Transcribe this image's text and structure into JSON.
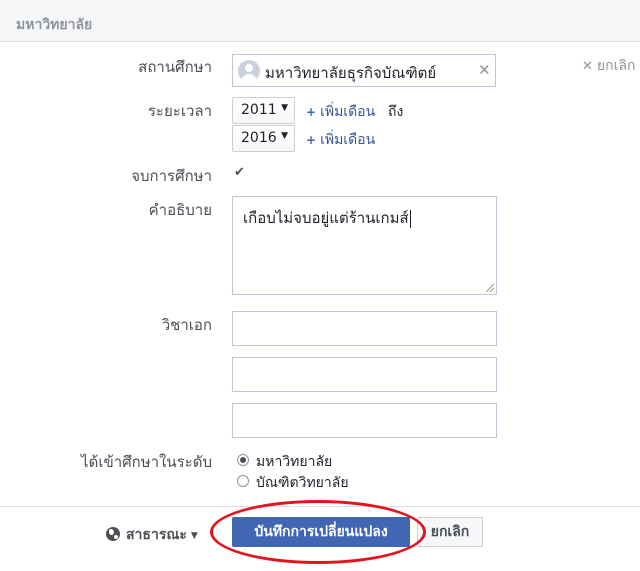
{
  "header": {
    "title": "มหาวิทยาลัย"
  },
  "form": {
    "school": {
      "label": "สถานศึกษา",
      "value": "มหาวิทยาลัยธุรกิจบัณฑิตย์",
      "clear_icon": "close-icon"
    },
    "cancel_top": "ยกเลิก",
    "period": {
      "label": "ระยะเวลา",
      "start_year": "2011",
      "end_year": "2016",
      "add_month": "เพิ่มเดือน",
      "to_text": "ถึง"
    },
    "graduated": {
      "label": "จบการศึกษา",
      "checked": true
    },
    "description": {
      "label": "คำอธิบาย",
      "value": "เกือบไม่จบอยู่แต่ร้านเกมส์"
    },
    "major": {
      "label": "วิชาเอก",
      "fields": [
        "",
        "",
        ""
      ]
    },
    "attended_for": {
      "label": "ได้เข้าศึกษาในระดับ",
      "options": [
        "มหาวิทยาลัย",
        "บัณฑิตวิทยาลัย"
      ],
      "selected": "มหาวิทยาลัย"
    }
  },
  "footer": {
    "privacy": "สาธารณะ",
    "save": "บันทึกการเปลี่ยนแปลง",
    "cancel": "ยกเลิก"
  },
  "colors": {
    "accent": "#4267b2",
    "link": "#365899",
    "highlight": "#e3141f"
  }
}
